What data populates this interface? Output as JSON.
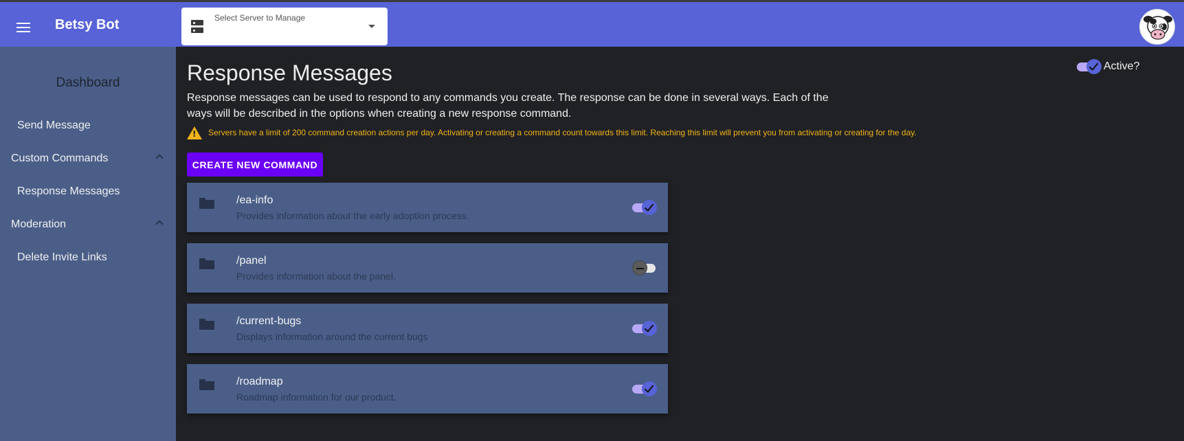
{
  "app": {
    "title": "Betsy Bot"
  },
  "server_select": {
    "label": "Select Server to Manage",
    "value": ""
  },
  "sidebar": {
    "dashboard": "Dashboard",
    "send_message": "Send Message",
    "custom_commands": "Custom Commands",
    "response_messages": "Response Messages",
    "moderation": "Moderation",
    "delete_invite_links": "Delete Invite Links"
  },
  "main": {
    "title": "Response Messages",
    "description": "Response messages can be used to respond to any commands you create. The response can be done in several ways. Each of the ways will be described in the options when creating a new response command.",
    "warning": "Servers have a limit of 200 command creation actions per day. Activating or creating a command count towards this limit. Reaching this limit will prevent you from activating or creating for the day.",
    "create_button": "CREATE NEW COMMAND",
    "active_label": "Active?",
    "active": true
  },
  "commands": [
    {
      "name": "/ea-info",
      "description": "Provides information about the early adoption process.",
      "enabled": true
    },
    {
      "name": "/panel",
      "description": "Provides information about the panel.",
      "enabled": false
    },
    {
      "name": "/current-bugs",
      "description": "Displays information around the current bugs",
      "enabled": true
    },
    {
      "name": "/roadmap",
      "description": "Roadmap information for our product.",
      "enabled": true
    }
  ],
  "colors": {
    "topbar": "#5763d6",
    "sidebar": "#4a5e88",
    "background": "#202125",
    "accent_button": "#6a00f4",
    "warning": "#f2b418"
  },
  "icons": {
    "menu": "menu-icon",
    "server": "server-icon",
    "dropdown": "arrow-drop-down-icon",
    "avatar": "cow-avatar",
    "warning": "warning-icon",
    "folder": "folder-icon",
    "chevron": "chevron-up-icon"
  }
}
